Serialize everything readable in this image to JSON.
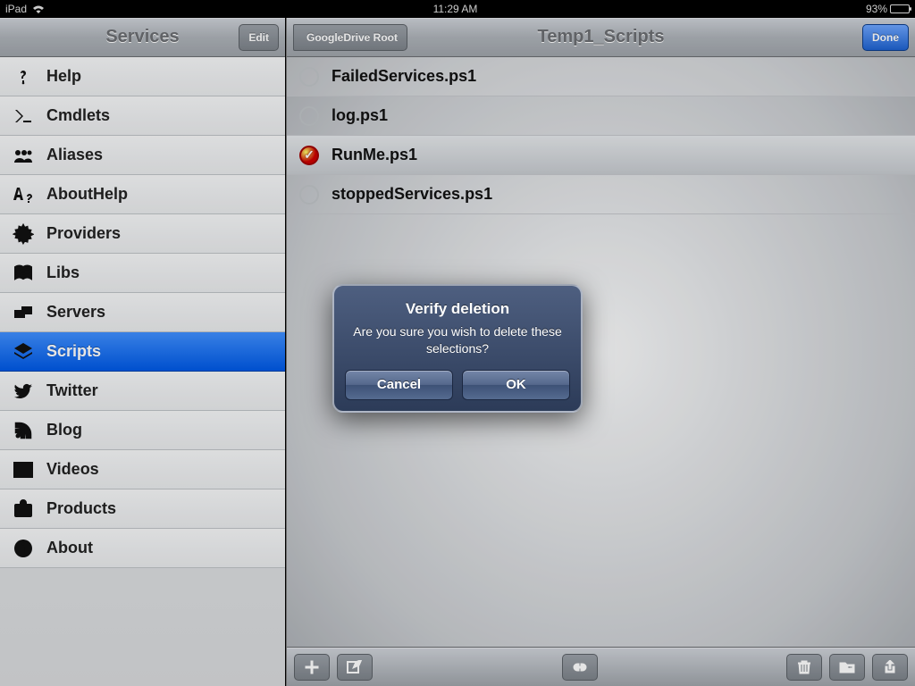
{
  "statusbar": {
    "device": "iPad",
    "time": "11:29 AM",
    "battery_pct": "93%"
  },
  "sidebar": {
    "title": "Services",
    "edit_label": "Edit",
    "items": [
      {
        "label": "Help",
        "icon": "help",
        "selected": false
      },
      {
        "label": "Cmdlets",
        "icon": "cmdlets",
        "selected": false
      },
      {
        "label": "Aliases",
        "icon": "aliases",
        "selected": false
      },
      {
        "label": "AboutHelp",
        "icon": "abouthelp",
        "selected": false
      },
      {
        "label": "Providers",
        "icon": "providers",
        "selected": false
      },
      {
        "label": "Libs",
        "icon": "libs",
        "selected": false
      },
      {
        "label": "Servers",
        "icon": "servers",
        "selected": false
      },
      {
        "label": "Scripts",
        "icon": "scripts",
        "selected": true
      },
      {
        "label": "Twitter",
        "icon": "twitter",
        "selected": false
      },
      {
        "label": "Blog",
        "icon": "blog",
        "selected": false
      },
      {
        "label": "Videos",
        "icon": "videos",
        "selected": false
      },
      {
        "label": "Products",
        "icon": "products",
        "selected": false
      },
      {
        "label": "About",
        "icon": "about",
        "selected": false
      }
    ]
  },
  "main": {
    "back_label": "GoogleDrive Root",
    "title": "Temp1_Scripts",
    "done_label": "Done",
    "files": [
      {
        "name": "FailedServices.ps1",
        "selected": false
      },
      {
        "name": "log.ps1",
        "selected": false
      },
      {
        "name": "RunMe.ps1",
        "selected": true
      },
      {
        "name": "stoppedServices.ps1",
        "selected": false
      }
    ]
  },
  "alert": {
    "title": "Verify deletion",
    "message": "Are you sure you wish to delete these selections?",
    "cancel": "Cancel",
    "ok": "OK"
  }
}
